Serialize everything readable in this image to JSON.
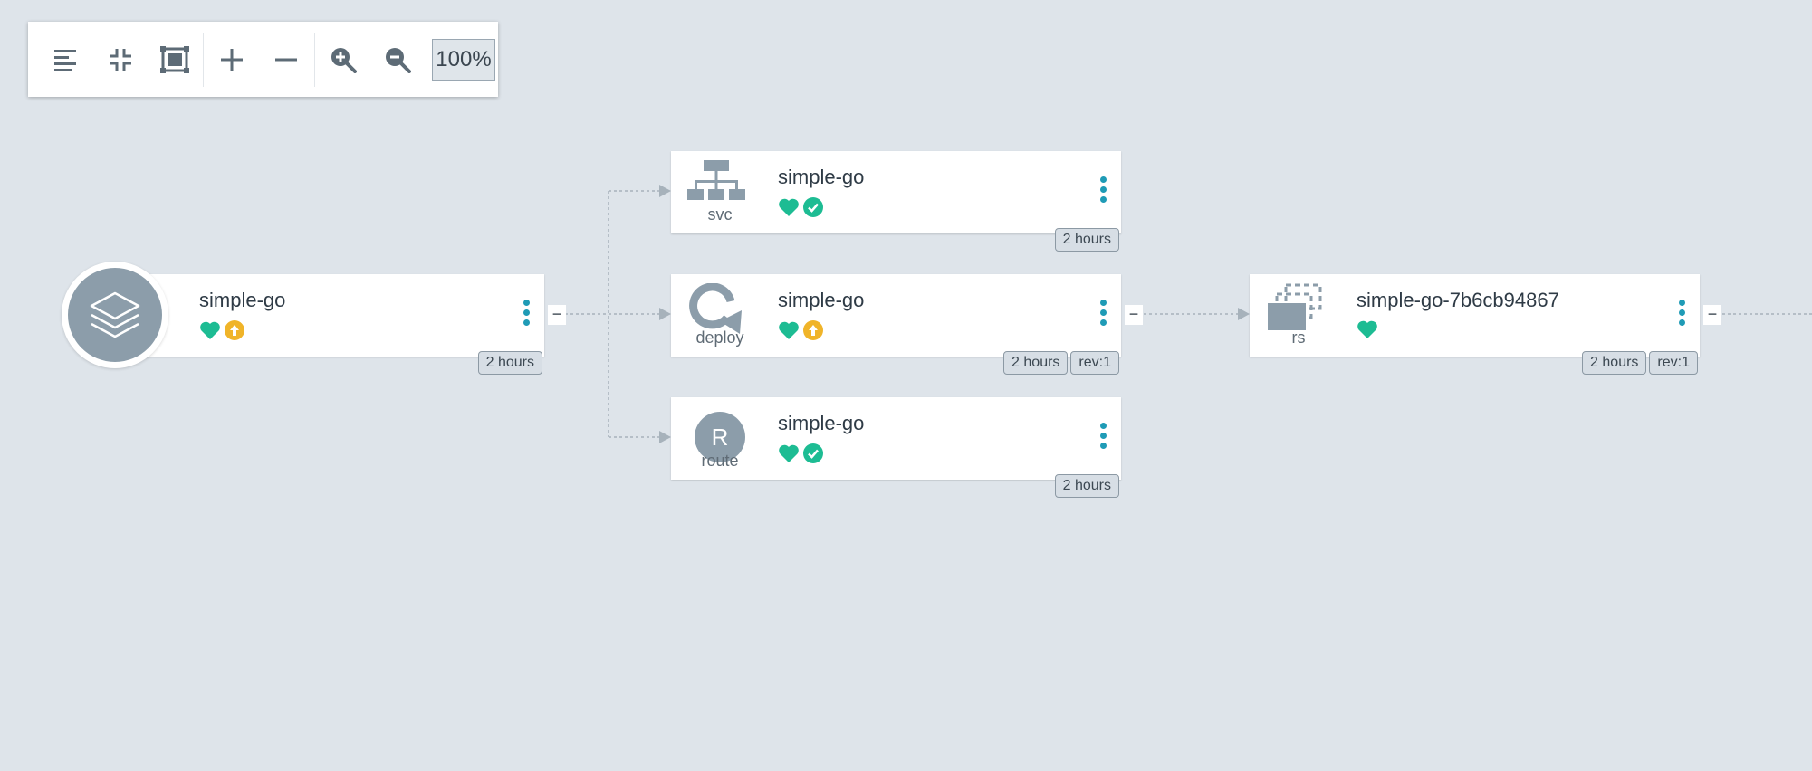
{
  "toolbar": {
    "zoom_level": "100%",
    "buttons": [
      "align-left-icon",
      "collapse-icon",
      "fit-to-screen-icon",
      "expand-all-icon",
      "collapse-all-icon",
      "zoom-in-icon",
      "zoom-out-icon"
    ]
  },
  "colors": {
    "background": "#dee4ea",
    "health_green": "#1dbc93",
    "sync_teal": "#1dbc93",
    "progressing_yellow": "#f0b429",
    "kebab": "#1f9bb6",
    "icon_gray": "#8c9daa"
  },
  "nodes": {
    "app": {
      "title": "simple-go",
      "age": "2 hours",
      "health": "heart-icon",
      "sync": "progressing-icon"
    },
    "svc": {
      "kind": "svc",
      "title": "simple-go",
      "age": "2 hours",
      "health": "heart-icon",
      "sync": "synced-check-icon"
    },
    "deploy": {
      "kind": "deploy",
      "title": "simple-go",
      "age": "2 hours",
      "revision": "rev:1",
      "health": "heart-icon",
      "sync": "progressing-icon"
    },
    "route": {
      "kind": "route",
      "icon_letter": "R",
      "title": "simple-go",
      "age": "2 hours",
      "health": "heart-icon",
      "sync": "synced-check-icon"
    },
    "rs": {
      "kind": "rs",
      "title": "simple-go-7b6cb94867",
      "age": "2 hours",
      "revision": "rev:1",
      "health": "heart-icon"
    }
  },
  "collapse_symbol": "−"
}
